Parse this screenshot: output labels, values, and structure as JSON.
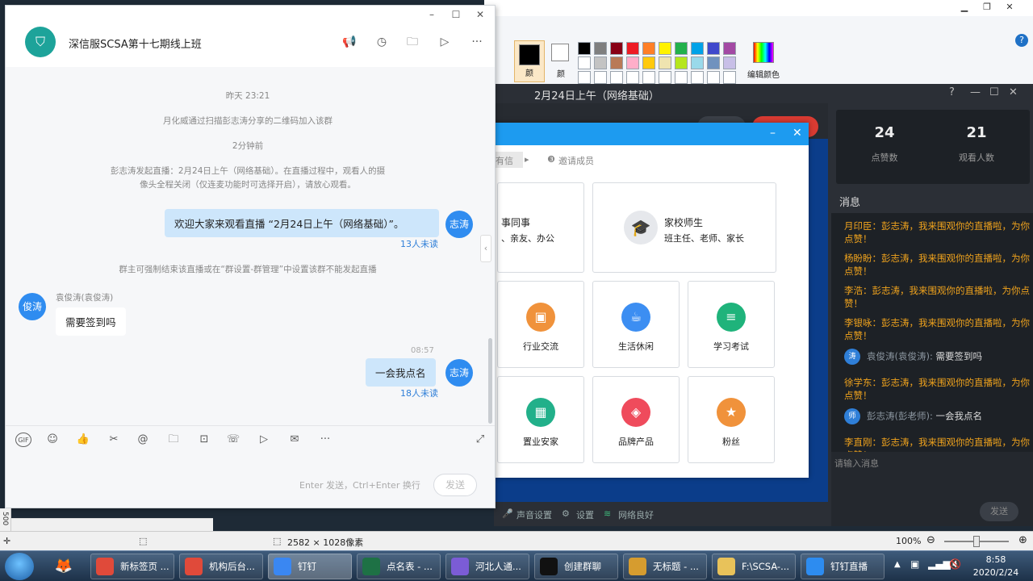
{
  "paint": {
    "color1_label": "颜",
    "color2_label": "颜",
    "edit_colors_label": "编辑颜色",
    "palette": [
      "#000000",
      "#7f7f7f",
      "#880015",
      "#ed1c24",
      "#ff7f27",
      "#fff200",
      "#22b14c",
      "#00a2e8",
      "#3f48cc",
      "#a349a4",
      "#ffffff",
      "#c3c3c3",
      "#b97a57",
      "#ffaec9",
      "#ffc90e",
      "#efe4b0",
      "#b5e61d",
      "#99d9ea",
      "#7092be",
      "#c8bfe7",
      "#ffffff",
      "#ffffff",
      "#ffffff",
      "#ffffff",
      "#ffffff",
      "#ffffff",
      "#ffffff",
      "#ffffff",
      "#ffffff",
      "#ffffff"
    ],
    "status": {
      "size": "2582 × 1028像素",
      "zoom": "100%",
      "left_ruler": "500"
    }
  },
  "live": {
    "title": "2月24日上午（网络基础）",
    "likes": "24",
    "likes_label": "点赞数",
    "viewers": "21",
    "viewers_label": "观看人数",
    "messages_title": "消息",
    "messages": [
      {
        "type": "sys",
        "text": "月印臣：彭志涛，我来围观你的直播啦，为你点赞！"
      },
      {
        "type": "sys",
        "text": "杨盼盼：彭志涛，我来围观你的直播啦，为你点赞！"
      },
      {
        "type": "sys",
        "text": "李浩：彭志涛，我来围观你的直播啦，为你点赞！"
      },
      {
        "type": "sys",
        "text": "李银咏：彭志涛，我来围观你的直播啦，为你点赞！"
      },
      {
        "type": "user",
        "avatar": "涛",
        "name": "袁俊涛(袁俊涛):",
        "text": "需要签到吗"
      },
      {
        "type": "sys",
        "text": "徐学东：彭志涛，我来围观你的直播啦，为你点赞！"
      },
      {
        "type": "user",
        "avatar": "师",
        "name": "彭志涛(彭老师):",
        "text": "一会我点名"
      },
      {
        "type": "sys",
        "text": "李直刚：彭志涛，我来围观你的直播啦，为你点赞！"
      }
    ],
    "input_placeholder": "请输入消息",
    "send_label": "发送",
    "bottom": {
      "audio": "声音设置",
      "settings": "设置",
      "network": "网络良好"
    }
  },
  "invite": {
    "step_label": "邀请成员",
    "step_prev": "有信",
    "tiles": [
      {
        "label": "行业交流",
        "color": "#f0923b",
        "icon": "briefcase-icon",
        "glyph": "▣"
      },
      {
        "label": "生活休闲",
        "color": "#3c8ef2",
        "icon": "cup-icon",
        "glyph": "☕"
      },
      {
        "label": "学习考试",
        "color": "#1fb37b",
        "icon": "book-icon",
        "glyph": "≡"
      },
      {
        "label": "置业安家",
        "color": "#22b08a",
        "icon": "building-icon",
        "glyph": "▦"
      },
      {
        "label": "品牌产品",
        "color": "#ef4b5c",
        "icon": "tag-icon",
        "glyph": "◈"
      },
      {
        "label": "粉丝",
        "color": "#f0923b",
        "icon": "star-icon",
        "glyph": "★"
      }
    ],
    "top_left_title": "事同事",
    "top_left_sub": "、亲友、办公",
    "top_right_title": "家校师生",
    "top_right_sub": "班主任、老师、家长"
  },
  "chat": {
    "group_name": "深信服SCSA第十七期线上班",
    "group_avatar": "⛉",
    "messages": {
      "time1": "昨天 23:21",
      "join_notice": "月化威通过扫描彭志涛分享的二维码加入该群",
      "time2": "2分钟前",
      "live_notice_1": "彭志涛发起直播：2月24日上午（网络基础）。在直播过程中，观看人的摄",
      "live_notice_2": "像头全程关闭（仅连麦功能时可选择开启），请放心观看。",
      "my_msg_1": "欢迎大家来观看直播 “2月24日上午（网络基础）”。",
      "my_avatar": "志涛",
      "unread_1": "13人未读",
      "owner_notice": "群主可强制结束该直播或在“群设置-群管理”中设置该群不能发起直播",
      "other_avatar": "俊涛",
      "other_name": "袁俊涛(袁俊涛)",
      "other_msg": "需要签到吗",
      "time3": "08:57",
      "my_msg_2": "一会我点名",
      "unread_2": "18人未读"
    },
    "send_hint": "Enter 发送，Ctrl+Enter 换行",
    "send_label": "发送",
    "toolbar_icons": [
      "gif-icon",
      "emoji-icon",
      "thumbs-up-icon",
      "scissors-icon",
      "at-icon",
      "folder-icon",
      "screenshot-icon",
      "phone-icon",
      "live-icon",
      "mail-icon",
      "more-icon"
    ]
  },
  "taskbar": {
    "tasks": [
      {
        "label": "新标签页 ...",
        "color": "#e04a3a"
      },
      {
        "label": "机构后台...",
        "color": "#e04a3a"
      },
      {
        "label": "钉钉",
        "color": "#3a87f2"
      },
      {
        "label": "点名表 - ...",
        "color": "#1e7145"
      },
      {
        "label": "河北人通...",
        "color": "#7b5cd6"
      },
      {
        "label": "创建群聊",
        "color": "#111111"
      },
      {
        "label": "无标题 - ...",
        "color": "#d69c2f"
      },
      {
        "label": "F:\\SCSA-...",
        "color": "#e8c25a"
      },
      {
        "label": "钉钉直播",
        "color": "#2d8cf0"
      }
    ],
    "time": "8:58",
    "date": "2020/2/24"
  }
}
